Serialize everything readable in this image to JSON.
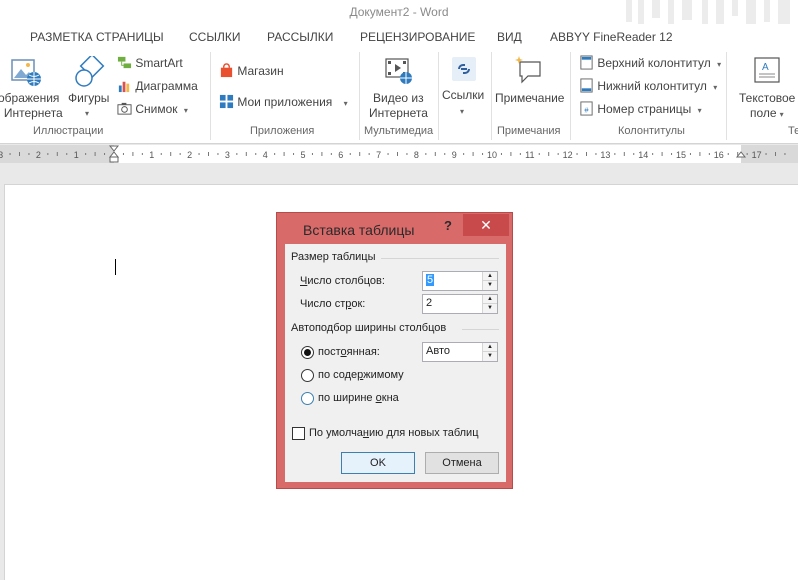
{
  "window": {
    "title": "Документ2 - Word"
  },
  "tabs": [
    {
      "label": "РАЗМЕТКА СТРАНИЦЫ"
    },
    {
      "label": "ССЫЛКИ"
    },
    {
      "label": "РАССЫЛКИ"
    },
    {
      "label": "РЕЦЕНЗИРОВАНИЕ"
    },
    {
      "label": "ВИД"
    },
    {
      "label": "ABBYY FineReader 12"
    }
  ],
  "ribbon": {
    "illustrations": {
      "online_images_l1": "ображения",
      "online_images_l2": "з Интернета",
      "shapes": "Фигуры",
      "smartart": "SmartArt",
      "chart": "Диаграмма",
      "screenshot": "Снимок",
      "label": "Иллюстрации"
    },
    "apps": {
      "store": "Магазин",
      "my_apps": "Мои приложения",
      "label": "Приложения"
    },
    "media": {
      "video_l1": "Видео из",
      "video_l2": "Интернета",
      "label": "Мультимедиа"
    },
    "links": {
      "links": "Ссылки"
    },
    "comments": {
      "comment": "Примечание",
      "label": "Примечания"
    },
    "header_footer": {
      "header": "Верхний колонтитул",
      "footer": "Нижний колонтитул",
      "page_number": "Номер страницы",
      "label": "Колонтитулы"
    },
    "text": {
      "textbox_l1": "Текстовое",
      "textbox_l2": "поле",
      "label_partial": "Те"
    }
  },
  "ruler": {
    "numbers": [
      "3",
      "2",
      "1",
      "1",
      "2",
      "3",
      "4",
      "5",
      "6",
      "7",
      "8",
      "9",
      "10",
      "11",
      "12",
      "13",
      "14",
      "15",
      "16",
      "17"
    ]
  },
  "dialog": {
    "title": "Вставка таблицы",
    "help": "?",
    "close": "✕",
    "size_section": "Размер таблицы",
    "columns_label_pre": "",
    "columns_label_u": "Ч",
    "columns_label_post": "исло столбцов:",
    "columns_value": "5",
    "rows_label_pre": "Число ст",
    "rows_label_u": "р",
    "rows_label_post": "ок:",
    "rows_value": "2",
    "autofit_section": "Автоподбор ширины столбцов",
    "fixed_pre": "пост",
    "fixed_u": "о",
    "fixed_post": "янная:",
    "fixed_value": "Авто",
    "content_pre": "по соде",
    "content_u": "р",
    "content_post": "жимому",
    "window_pre": "по ширине ",
    "window_u": "о",
    "window_post": "кна",
    "default_pre": "По умолча",
    "default_u": "н",
    "default_post": "ию для новых таблиц",
    "ok": "OK",
    "cancel": "Отмена"
  }
}
